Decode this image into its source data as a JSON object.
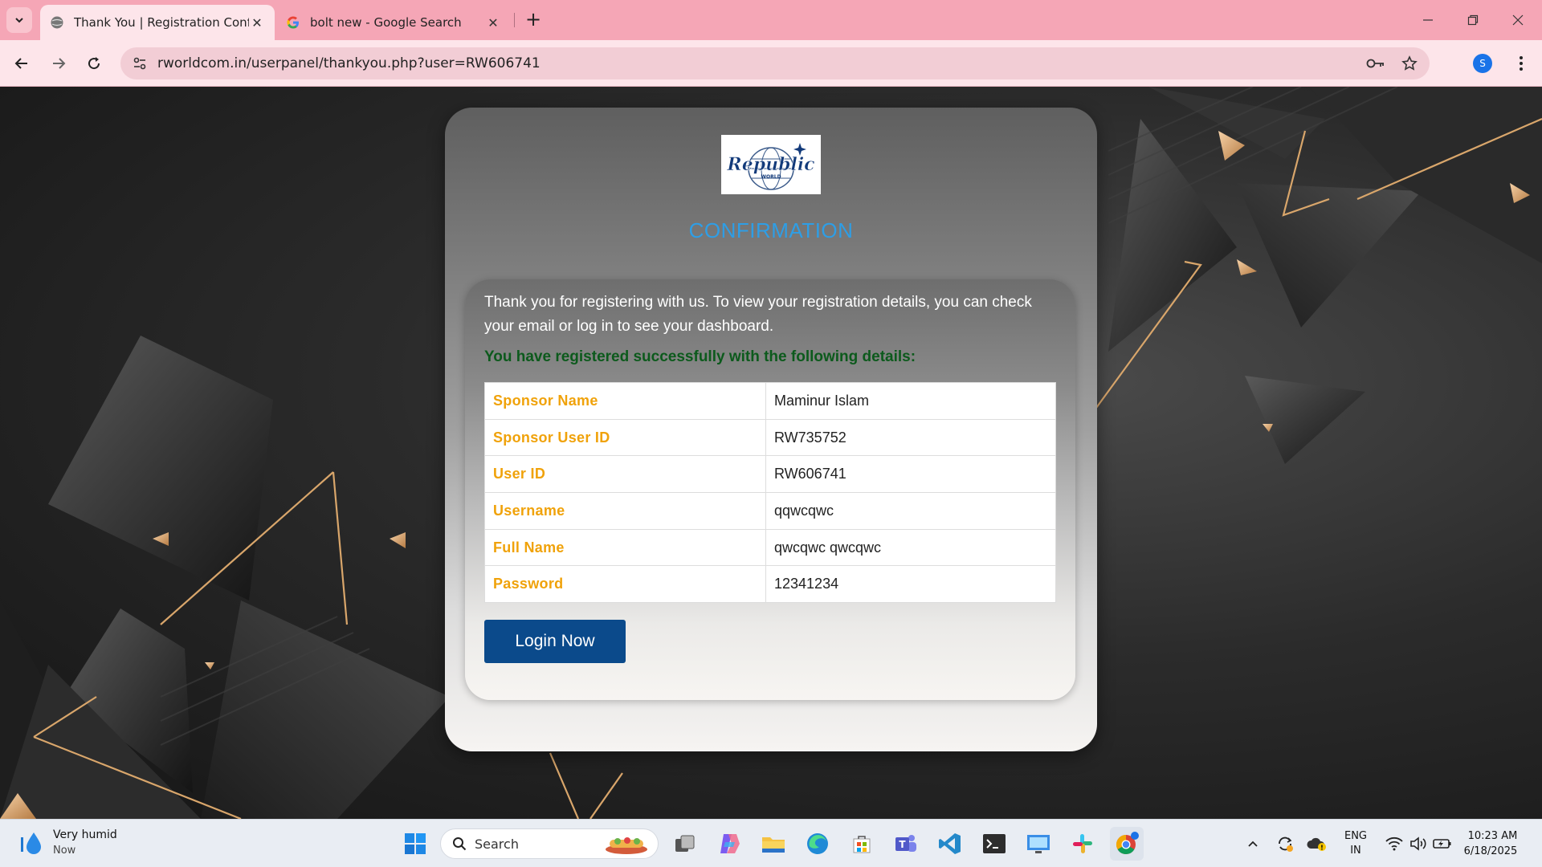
{
  "browser": {
    "tabs": [
      {
        "title": "Thank You | Registration Confirmation",
        "active": true
      },
      {
        "title": "bolt new - Google Search",
        "active": false
      }
    ],
    "url": "rworldcom.in/userpanel/thankyou.php?user=RW606741",
    "profile_initial": "S"
  },
  "card": {
    "logo_text": "Republic",
    "logo_subtext": "WORLD",
    "title": "CONFIRMATION",
    "intro": "Thank you for registering with us. To view your registration details, you can check your email or log in to see your dashboard.",
    "success_message": "You have registered successfully with the following details:",
    "details": [
      {
        "label": "Sponsor Name",
        "value": "Maminur Islam"
      },
      {
        "label": "Sponsor User ID",
        "value": "RW735752"
      },
      {
        "label": "User ID",
        "value": "RW606741"
      },
      {
        "label": "Username",
        "value": "qqwcqwc"
      },
      {
        "label": "Full Name",
        "value": "qwcqwc qwcqwc"
      },
      {
        "label": "Password",
        "value": "12341234"
      }
    ],
    "login_label": "Login Now"
  },
  "taskbar": {
    "weather_title": "Very humid",
    "weather_sub": "Now",
    "search_placeholder": "Search",
    "lang_line1": "ENG",
    "lang_line2": "IN",
    "time": "10:23 AM",
    "date": "6/18/2025"
  },
  "colors": {
    "tab_strip": "#f5a6b6",
    "toolbar": "#fde5ea",
    "title_blue": "#2e9ee6",
    "label_orange": "#f0a20a",
    "success_green": "#0c5a1c",
    "button_navy": "#0b4a8b"
  }
}
